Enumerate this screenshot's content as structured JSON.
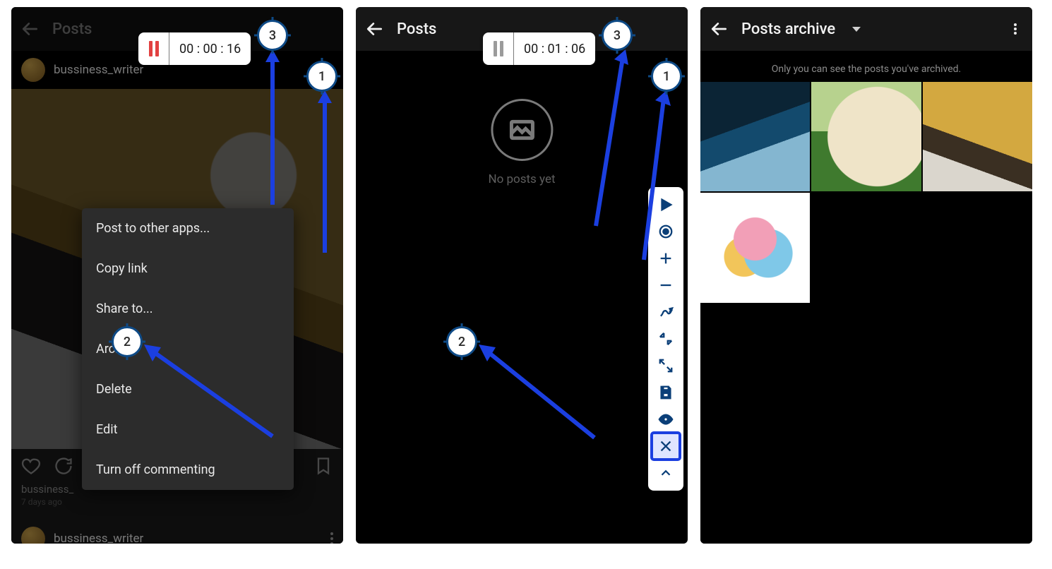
{
  "screens": {
    "s1": {
      "title": "Posts",
      "timer": "00 : 00 : 16",
      "username": "bussiness_writer",
      "caption_user": "bussiness_",
      "ago": "7 days ago",
      "next_username": "bussiness_writer",
      "menu": {
        "post_other": "Post to other apps...",
        "copy_link": "Copy link",
        "share_to": "Share to...",
        "archive": "Archive",
        "delete": "Delete",
        "edit": "Edit",
        "turn_off": "Turn off commenting"
      },
      "markers": {
        "m1": "1",
        "m2": "2",
        "m3": "3"
      }
    },
    "s2": {
      "title": "Posts",
      "timer": "00 : 01 : 06",
      "no_posts": "No posts yet",
      "markers": {
        "m1": "1",
        "m2": "2",
        "m3": "3"
      }
    },
    "s3": {
      "title": "Posts archive",
      "note": "Only you can see the posts you've archived."
    }
  }
}
